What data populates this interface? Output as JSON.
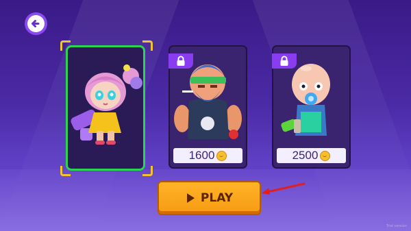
{
  "screen": "character-select",
  "colors": {
    "accent": "#8a4cf0",
    "selected_border": "#2bd452",
    "play_button": "#f79a12",
    "arrow": "#e02020"
  },
  "characters": [
    {
      "name": "girl-with-bazooka",
      "state": "selected"
    },
    {
      "name": "biker",
      "state": "locked",
      "price": "1600",
      "currency_icon": "coin-icon"
    },
    {
      "name": "baby",
      "state": "locked",
      "price": "2500",
      "currency_icon": "coin-icon"
    }
  ],
  "play_button": {
    "label": "PLAY",
    "icon": "play-triangle-icon"
  },
  "watermark": "Trial version"
}
